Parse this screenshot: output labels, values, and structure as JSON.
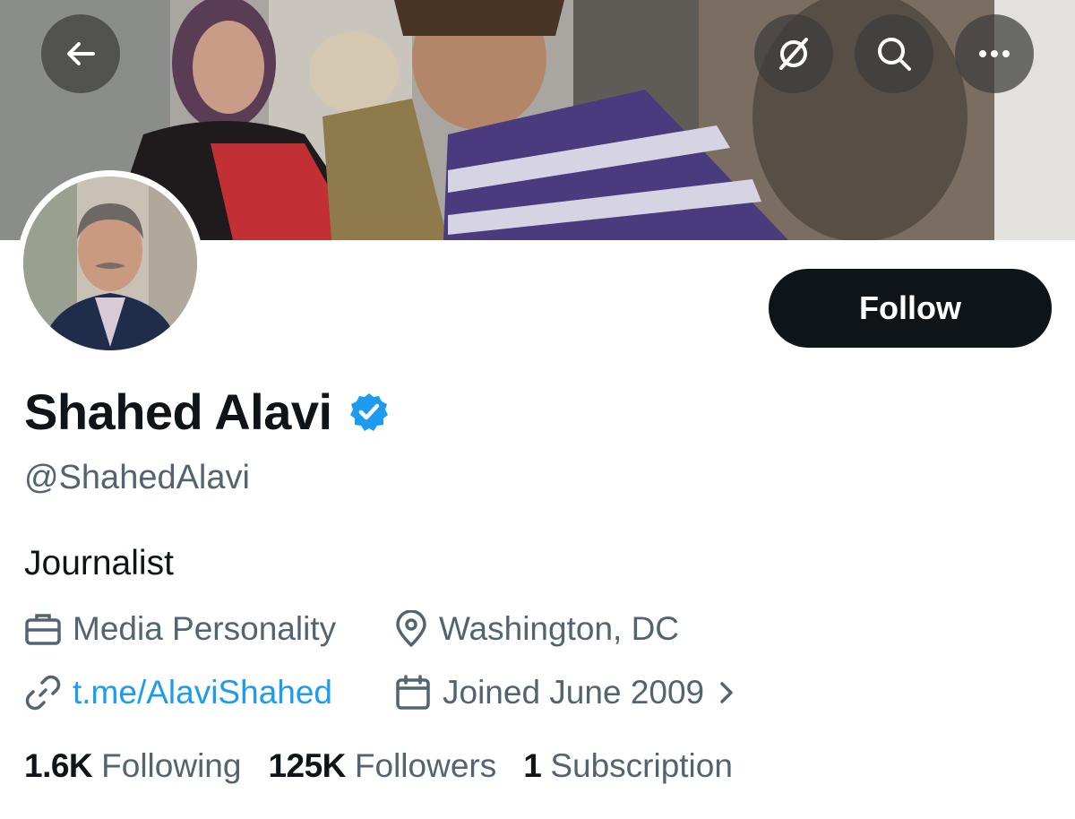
{
  "header": {
    "back_icon": "arrow-left-icon",
    "grok_icon": "grok-icon",
    "search_icon": "search-icon",
    "more_icon": "ellipsis-icon"
  },
  "profile": {
    "display_name": "Shahed Alavi",
    "verified": true,
    "verified_color": "#1d9bf0",
    "handle": "@ShahedAlavi",
    "bio": "Journalist",
    "category": "Media Personality",
    "location": "Washington, DC",
    "website": "t.me/AlaviShahed",
    "joined": "Joined June 2009",
    "follow_label": "Follow"
  },
  "stats": {
    "following_count": "1.6K",
    "following_label": "Following",
    "followers_count": "125K",
    "followers_label": "Followers",
    "subscriptions_count": "1",
    "subscriptions_label": "Subscription"
  },
  "colors": {
    "text_primary": "#0f1419",
    "text_secondary": "#536471",
    "link": "#1d9bf0",
    "follow_button_bg": "#0f1419"
  }
}
